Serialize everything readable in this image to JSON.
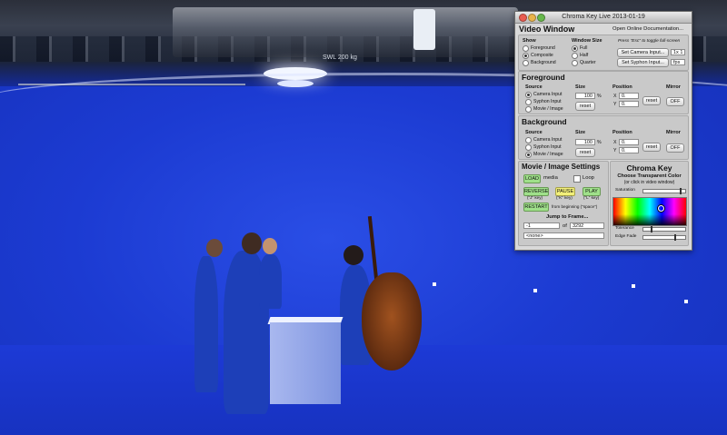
{
  "scene": {
    "label": "SWL 200 kg"
  },
  "window": {
    "title": "Chroma Key Live 2013-01-19"
  },
  "video_window": {
    "heading": "Video Window",
    "docs_link": "Open Online Documentation...",
    "show_label": "Show",
    "show_options": [
      "Foreground",
      "Composite",
      "Background"
    ],
    "show_selected": "Composite",
    "size_label": "Window Size",
    "size_options": [
      "Full",
      "Half",
      "Quarter"
    ],
    "size_selected": "Full",
    "esc_hint": "Press \"Esc\" to toggle full-screen",
    "camera_button": "Set Camera Input...",
    "syphon_button": "Set Syphon Input...",
    "camera_value": "1x 1",
    "syphon_value": "fps"
  },
  "foreground": {
    "heading": "Foreground",
    "source_label": "Source",
    "source_options": [
      "Camera Input",
      "Syphon Input",
      "Movie / Image"
    ],
    "source_selected": "Camera Input",
    "size_label": "Size",
    "size_value": "100",
    "percent": "%",
    "size_reset": "reset",
    "position_label": "Position",
    "x_label": "X",
    "y_label": "Y",
    "x_value": "0.",
    "y_value": "0.",
    "position_reset": "reset",
    "mirror_label": "Mirror",
    "mirror_value": "OFF"
  },
  "background": {
    "heading": "Background",
    "source_label": "Source",
    "source_options": [
      "Camera Input",
      "Syphon Input",
      "Movie / Image"
    ],
    "source_selected": "Movie / Image",
    "size_label": "Size",
    "size_value": "100",
    "percent": "%",
    "size_reset": "reset",
    "position_label": "Position",
    "x_label": "X",
    "y_label": "Y",
    "x_value": "0.",
    "y_value": "0.",
    "position_reset": "reset",
    "mirror_label": "Mirror",
    "mirror_value": "OFF"
  },
  "movie": {
    "heading": "Movie / Image Settings",
    "load_button": "LOAD",
    "media_label": "media",
    "loop_label": "Loop",
    "reverse_button": "REVERSE",
    "reverse_key": "(\"J\" key)",
    "pause_button": "PAUSE",
    "pause_key": "(\"K\" key)",
    "play_button": "PLAY",
    "play_key": "(\"L\" key)",
    "restart_button": "RESTART",
    "restart_hint": "from beginning (\"space\")",
    "jump_label": "Jump to Frame...",
    "frame_value": "-1",
    "of_label": "of",
    "frame_total": "3292",
    "media_name": "<none>"
  },
  "chroma": {
    "heading": "Chroma Key",
    "subheading": "Choose Transparent Color",
    "hint": "(or click in video window)",
    "saturation_label": "Saturation",
    "saturation_level": 0.9,
    "tolerance_label": "Tolerance",
    "tolerance_level": 0.2,
    "edge_label": "Edge Fade",
    "edge_level": 0.75
  },
  "colors": {
    "green_button": "#9fe08a",
    "yellow_button": "#f2ef7a",
    "blue_screen": "#1c3bd2"
  }
}
